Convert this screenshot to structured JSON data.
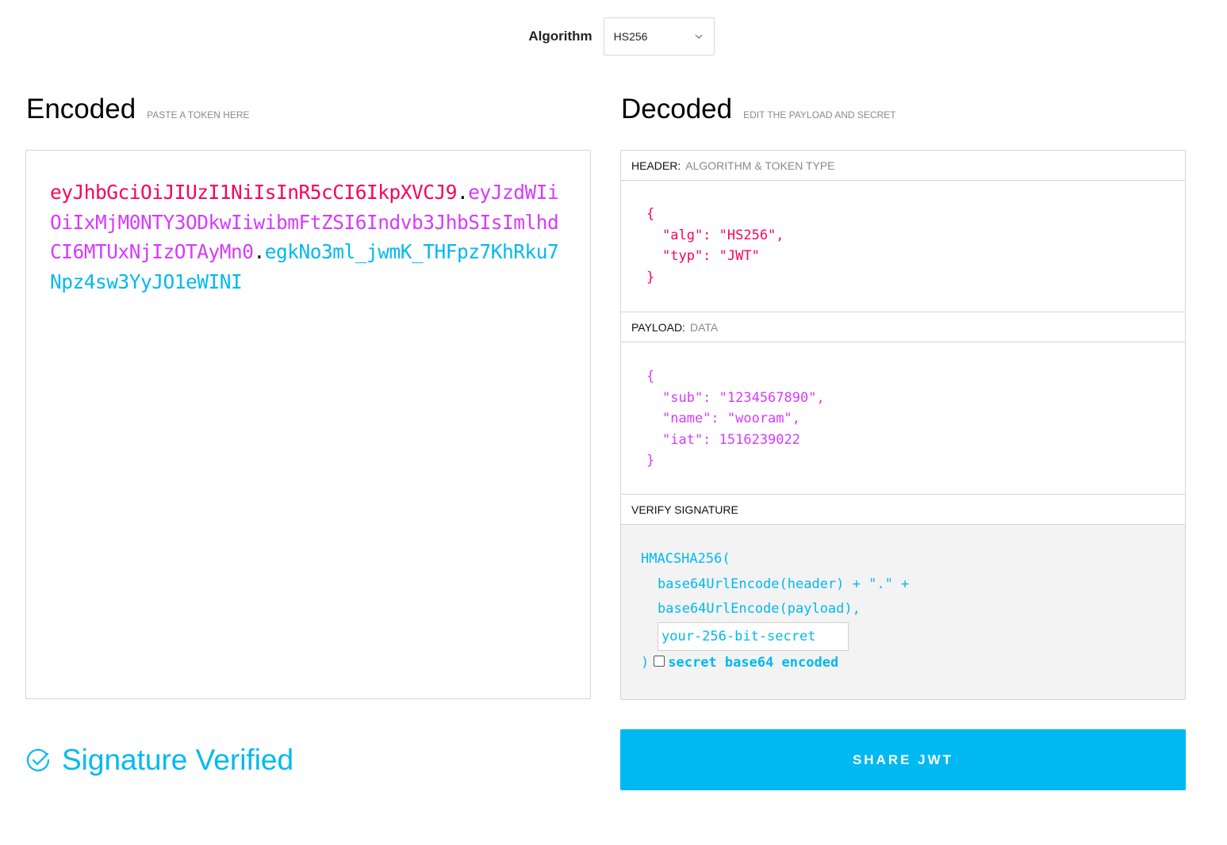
{
  "algorithm": {
    "label": "Algorithm",
    "selected": "HS256"
  },
  "encoded": {
    "title": "Encoded",
    "subtitle": "PASTE A TOKEN HERE",
    "token_header": "eyJhbGciOiJIUzI1NiIsInR5cCI6IkpXVCJ9",
    "dot1": ".",
    "token_payload": "eyJzdWIiOiIxMjM0NTY3ODkwIiwibmFtZSI6Indvb3JhbSIsImlhdCI6MTUxNjIzOTAyMn0",
    "dot2": ".",
    "token_signature": "egkNo3ml_jwmK_THFpz7KhRku7Npz4sw3YyJO1eWINI"
  },
  "decoded": {
    "title": "Decoded",
    "subtitle": "EDIT THE PAYLOAD AND SECRET",
    "header_section": {
      "label": "HEADER:",
      "sublabel": "ALGORITHM & TOKEN TYPE",
      "lines": [
        "{",
        "\"alg\": \"HS256\",",
        "\"typ\": \"JWT\"",
        "}"
      ]
    },
    "payload_section": {
      "label": "PAYLOAD:",
      "sublabel": "DATA",
      "lines": [
        "{",
        "\"sub\": \"1234567890\",",
        "\"name\": \"wooram\",",
        "\"iat\": 1516239022",
        "}"
      ]
    },
    "verify_section": {
      "label": "VERIFY SIGNATURE",
      "fn_open": "HMACSHA256(",
      "line_header": "base64UrlEncode(header) + \".\" +",
      "line_payload": "base64UrlEncode(payload),",
      "secret_placeholder": "your-256-bit-secret",
      "fn_close": ")",
      "base64_label": "secret base64 encoded",
      "base64_checked": false
    }
  },
  "status": {
    "text": "Signature Verified",
    "icon": "check-circle-icon"
  },
  "share_button": "SHARE JWT",
  "colors": {
    "header": "#fb015b",
    "payload": "#d63aff",
    "signature": "#00b9f1"
  }
}
